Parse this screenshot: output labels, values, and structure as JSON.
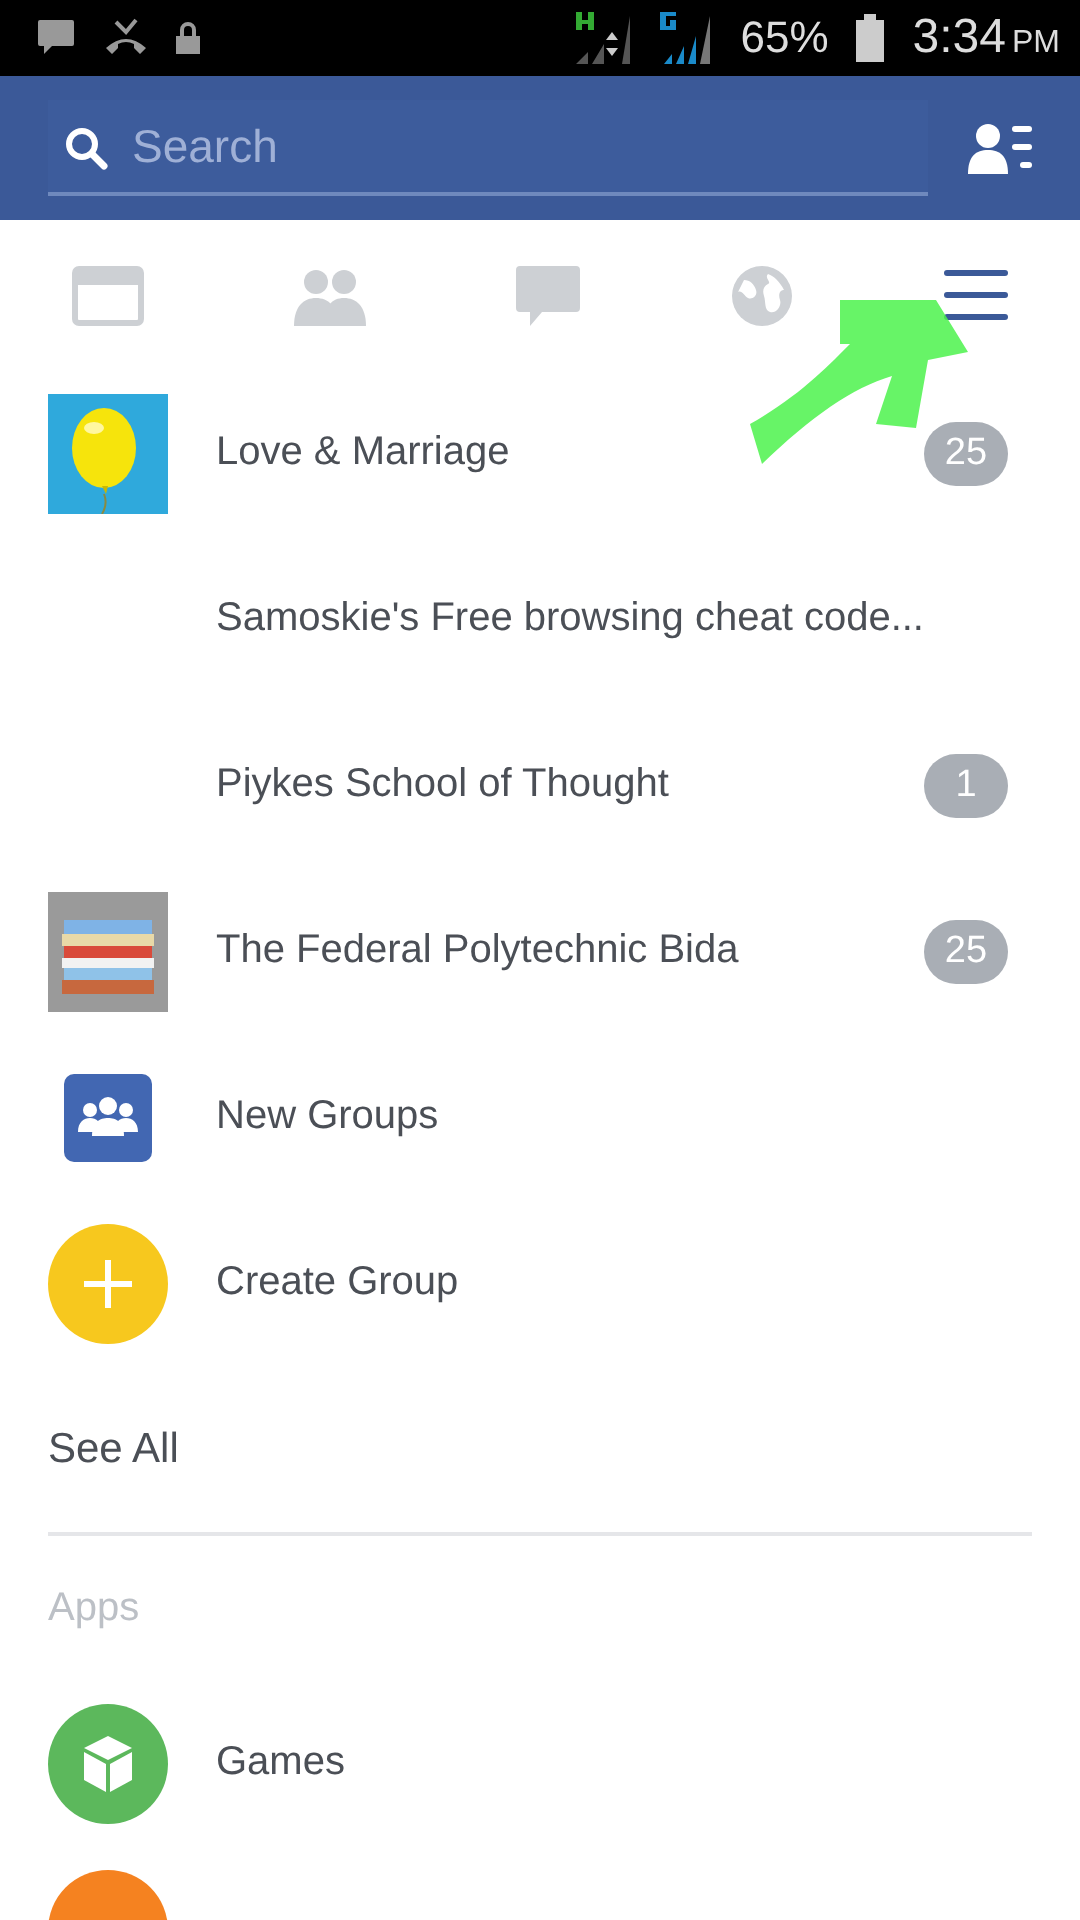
{
  "status_bar": {
    "battery": "65%",
    "time": "3:34",
    "ampm": "PM"
  },
  "search": {
    "placeholder": "Search"
  },
  "tabs": [
    {
      "kind": "feed",
      "selected": false
    },
    {
      "kind": "friends",
      "selected": false
    },
    {
      "kind": "messages",
      "selected": false
    },
    {
      "kind": "notifications",
      "selected": false
    },
    {
      "kind": "menu",
      "selected": true
    }
  ],
  "groups": [
    {
      "kind": "balloon",
      "label": "Love & Marriage",
      "badge": "25"
    },
    {
      "kind": "none",
      "label": "Samoskie's Free browsing cheat code..."
    },
    {
      "kind": "none",
      "label": "Piykes School of Thought",
      "badge": "1"
    },
    {
      "kind": "books",
      "label": "The Federal Polytechnic Bida",
      "badge": "25"
    },
    {
      "kind": "new-groups",
      "label": "New Groups"
    },
    {
      "kind": "create",
      "label": "Create Group"
    }
  ],
  "see_all": "See All",
  "apps": {
    "title": "Apps",
    "items": [
      {
        "kind": "games",
        "label": "Games",
        "color": "#5cb85c"
      },
      {
        "kind": "partial",
        "color": "#f58220"
      }
    ]
  }
}
